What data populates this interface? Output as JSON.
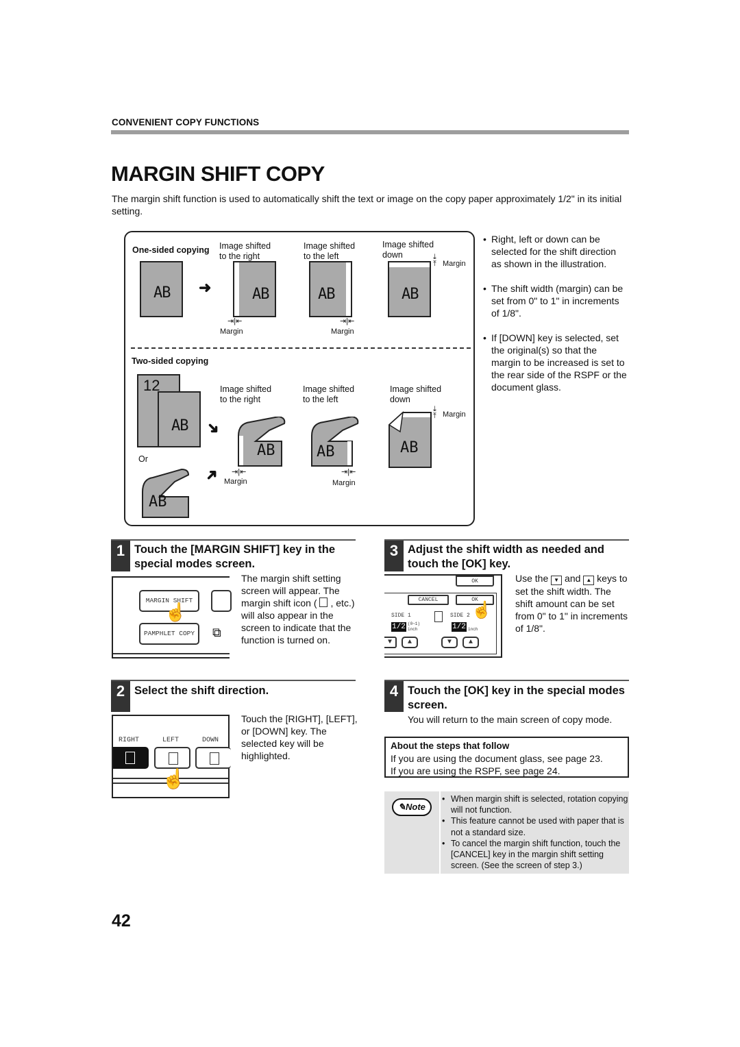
{
  "header": {
    "section_label": "CONVENIENT COPY FUNCTIONS",
    "page_title": "MARGIN SHIFT COPY",
    "intro": "The margin shift function is used to automatically shift the text or image on the copy paper approximately 1/2\" in its initial setting."
  },
  "illustration": {
    "one_sided_label": "One-sided copying",
    "two_sided_label": "Two-sided copying",
    "shift_right": "Image shifted\nto the right",
    "shift_left": "Image shifted\nto the left",
    "shift_down": "Image shifted\ndown",
    "shift_right_l1": "Image shifted",
    "shift_right_l2": "to the right",
    "shift_left_l1": "Image shifted",
    "shift_left_l2": "to the left",
    "shift_down_l1": "Image shifted",
    "shift_down_l2": "down",
    "margin": "Margin",
    "or": "Or",
    "page_text": "AB",
    "duplex_numbers": "12"
  },
  "side_bullets": [
    "Right, left or down can be selected for the shift direction as shown in the illustration.",
    "The shift width (margin) can be set from 0\" to 1\" in increments of 1/8\".",
    "If [DOWN] key is selected, set the original(s) so that the margin  to be increased is set to the rear side of the RSPF or the document glass."
  ],
  "steps": [
    {
      "number": "1",
      "title": "Touch the [MARGIN SHIFT] key in the special modes screen.",
      "text_parts": [
        "The margin shift setting screen will appear. The margin shift icon (",
        ", etc.) will also appear in  the screen to indicate that the function is turned on."
      ],
      "screen": {
        "key1": "MARGIN SHIFT",
        "key2": "PAMPHLET COPY"
      }
    },
    {
      "number": "2",
      "title": "Select the shift direction.",
      "text": "Touch the [RIGHT], [LEFT], or [DOWN] key. The selected key will be highlighted.",
      "screen": {
        "right": "RIGHT",
        "left": "LEFT",
        "down": "DOWN",
        "selected": "RIGHT"
      }
    },
    {
      "number": "3",
      "title": "Adjust the shift width as needed and touch the [OK] key.",
      "text_a": "Use the",
      "text_b": "and",
      "text_c": "keys to set the shift width. The shift amount can be set from 0\" to 1\" in increments of 1/8\".",
      "screen": {
        "ok_top": "OK",
        "cancel": "CANCEL",
        "ok": "OK",
        "side1": "SIDE 1",
        "side2": "SIDE 2",
        "value1": "1/2",
        "value2": "1/2",
        "range": "(0~1)",
        "unit": "inch"
      }
    },
    {
      "number": "4",
      "title": "Touch the [OK] key in the special modes screen.",
      "text": "You will return to the main screen of copy mode."
    }
  ],
  "about_box": {
    "title": "About the steps that follow",
    "line1": "If you are using the document glass, see page 23.",
    "line2": "If you are using the RSPF, see page 24."
  },
  "note": {
    "badge": "Note",
    "items": [
      "When margin shift is selected, rotation copying will not function.",
      "This feature cannot be used with paper that is not a standard size.",
      "To cancel the margin shift function, touch the [CANCEL] key in the margin shift setting screen. (See the screen of step 3.)"
    ]
  },
  "footer": {
    "page_number": "42"
  }
}
